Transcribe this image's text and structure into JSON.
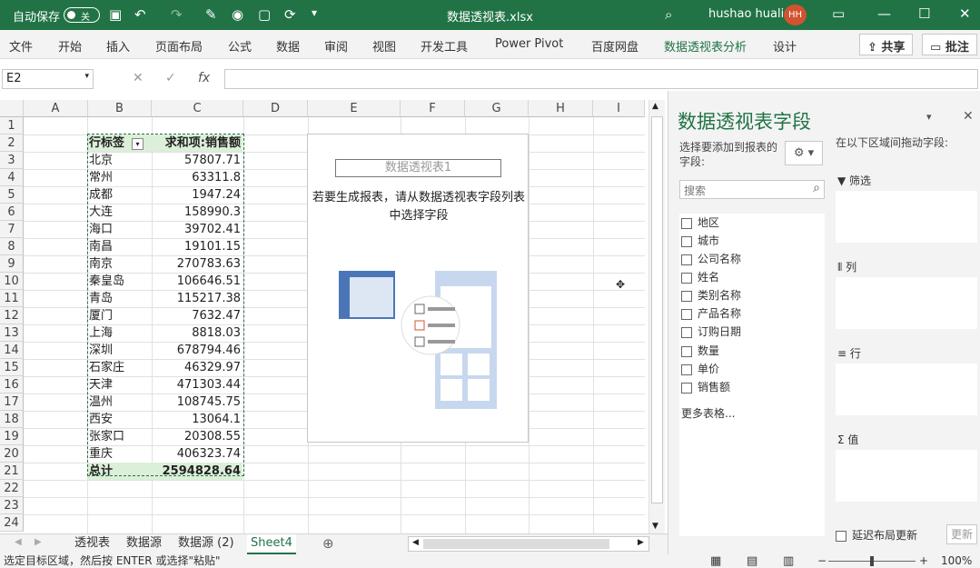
{
  "titlebar": {
    "autosave": "自动保存",
    "toggle": "关",
    "title": "数据透视表.xlsx",
    "user": "hushao huali",
    "initials": "HH"
  },
  "ribbon": {
    "tabs": [
      "文件",
      "开始",
      "插入",
      "页面布局",
      "公式",
      "数据",
      "审阅",
      "视图",
      "开发工具",
      "Power Pivot",
      "百度网盘",
      "数据透视表分析",
      "设计"
    ],
    "share": "共享",
    "comment": "批注"
  },
  "formula": {
    "namebox": "E2",
    "fx": "fx"
  },
  "columns": [
    "A",
    "B",
    "C",
    "D",
    "E",
    "F",
    "G",
    "H",
    "I"
  ],
  "rows": [
    "1",
    "2",
    "3",
    "4",
    "5",
    "6",
    "7",
    "8",
    "9",
    "10",
    "11",
    "12",
    "13",
    "14",
    "15",
    "16",
    "17",
    "18",
    "19",
    "20",
    "21",
    "22",
    "23",
    "24"
  ],
  "pivot": {
    "row_label": "行标签",
    "value_label": "求和项:销售额",
    "items": [
      [
        "北京",
        "57807.71"
      ],
      [
        "常州",
        "63311.8"
      ],
      [
        "成都",
        "1947.24"
      ],
      [
        "大连",
        "158990.3"
      ],
      [
        "海口",
        "39702.41"
      ],
      [
        "南昌",
        "19101.15"
      ],
      [
        "南京",
        "270783.63"
      ],
      [
        "秦皇岛",
        "106646.51"
      ],
      [
        "青岛",
        "115217.38"
      ],
      [
        "厦门",
        "7632.47"
      ],
      [
        "上海",
        "8818.03"
      ],
      [
        "深圳",
        "678794.46"
      ],
      [
        "石家庄",
        "46329.97"
      ],
      [
        "天津",
        "471303.44"
      ],
      [
        "温州",
        "108745.75"
      ],
      [
        "西安",
        "13064.1"
      ],
      [
        "张家口",
        "20308.55"
      ],
      [
        "重庆",
        "406323.74"
      ]
    ],
    "total_label": "总计",
    "total_value": "2594828.64"
  },
  "placeholder": {
    "title": "数据透视表1",
    "text": "若要生成报表，请从数据透视表字段列表中选择字段"
  },
  "sheets": [
    "透视表",
    "数据源",
    "数据源 (2)",
    "Sheet4"
  ],
  "status": "选定目标区域，然后按 ENTER 或选择\"粘贴\"",
  "zoom": "100%",
  "pane": {
    "title": "数据透视表字段",
    "choose": "选择要添加到报表的字段:",
    "search": "搜索",
    "fields": [
      "地区",
      "城市",
      "公司名称",
      "姓名",
      "类别名称",
      "产品名称",
      "订购日期",
      "数量",
      "单价",
      "销售额"
    ],
    "more": "更多表格...",
    "drag": "在以下区域间拖动字段:",
    "areas": [
      "筛选",
      "列",
      "行",
      "值"
    ],
    "defer": "延迟布局更新",
    "update": "更新"
  }
}
